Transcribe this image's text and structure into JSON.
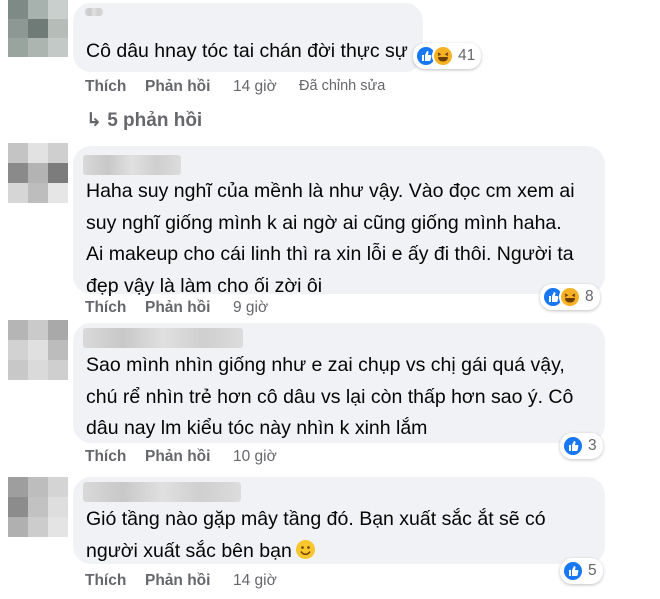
{
  "comments": [
    {
      "text": "Cô dâu hnay tóc tai chán đời thực sự",
      "like_label": "Thích",
      "reply_label": "Phản hồi",
      "time": "14 giờ",
      "edited": "Đã chỉnh sửa",
      "reaction_count": "41"
    },
    {
      "view_replies": "↳ 5 phản hồi"
    },
    {
      "text": "Haha suy nghĩ của mềnh là như vậy. Vào đọc cm xem ai\nsuy nghĩ giống mình k ai ngờ ai cũng giống mình haha.\nAi makeup cho cái linh thì ra xin lỗi e ấy đi thôi. Người ta\nđẹp vậy là làm cho ối zời ôi",
      "like_label": "Thích",
      "reply_label": "Phản hồi",
      "time": "9 giờ",
      "reaction_count": "8"
    },
    {
      "text": "Sao mình nhìn giống như e zai chụp vs chị gái quá vậy,\nchú rể nhìn trẻ hơn cô dâu vs lại còn thấp hơn sao ý. Cô\ndâu nay lm kiểu tóc này nhìn k xinh lắm",
      "like_label": "Thích",
      "reply_label": "Phản hồi",
      "time": "10 giờ",
      "reaction_count": "3"
    },
    {
      "text": "Gió tầng nào gặp mây tầng đó. Bạn xuất sắc ắt sẽ có\nngười xuất sắc bên bạn",
      "like_label": "Thích",
      "reply_label": "Phản hồi",
      "time": "14 giờ",
      "reaction_count": "5"
    }
  ],
  "colors": {
    "bubble": "#f0f2f5",
    "meta": "#65676b",
    "like": "#1877f2",
    "haha": "#f7b125"
  }
}
